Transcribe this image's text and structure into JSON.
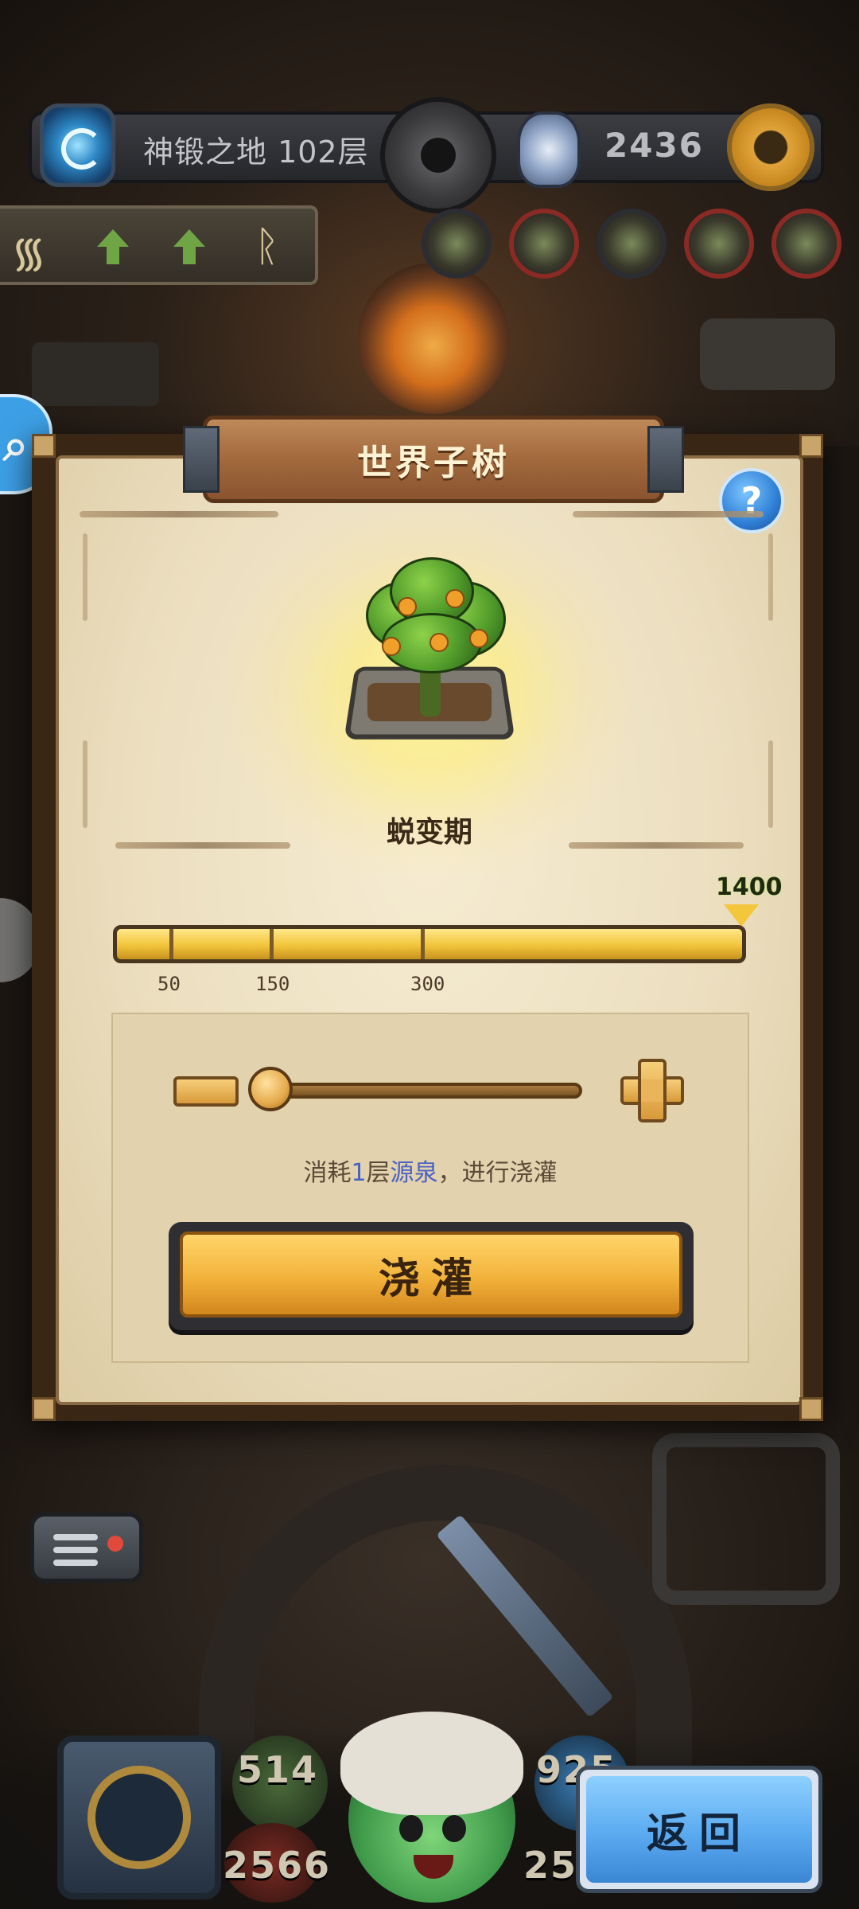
{
  "header": {
    "level_title": "神锻之地 102层",
    "crystal_count": "2436"
  },
  "dialog": {
    "title": "世界子树",
    "help_label": "?",
    "stage": "蜕变期",
    "progress": {
      "max_label": "1400",
      "ticks": [
        "50",
        "150",
        "300"
      ],
      "fill_fraction": 1.0
    },
    "slider": {
      "value_fraction": 0.0
    },
    "consume": {
      "prefix": "消耗",
      "count": "1",
      "mid": "层",
      "resource": "源泉",
      "suffix": "，进行浇灌"
    },
    "water_button": "浇灌"
  },
  "hud": {
    "stat_left_top": "514",
    "stat_left_bottom": "2566",
    "stat_right_top": "925",
    "stat_right_bottom": "25",
    "back_button": "返回"
  },
  "icons": {
    "portal": "portal-icon",
    "crystal": "crystal-icon",
    "settings": "gear-icon",
    "search": "search-icon",
    "gift": "gift-icon",
    "radio": "radio-icon"
  },
  "colors": {
    "accent_gold": "#f2c43a",
    "help_blue": "#2f7fd6",
    "highlight_blue": "#4a62c4",
    "back_blue": "#5aaaf0"
  }
}
